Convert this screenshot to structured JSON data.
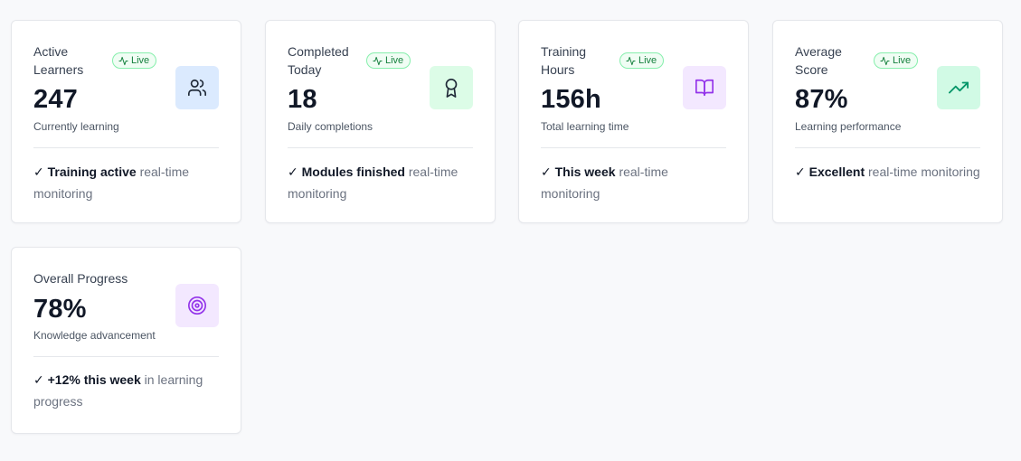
{
  "colors": {
    "live_badge_bg": "#f0fdf4",
    "live_badge_border": "#86efac",
    "live_badge_text": "#15803d",
    "blue_icon_bg": "#dbeafe",
    "green_icon_bg": "#dcfce7",
    "purple_icon_bg": "#f3e8ff",
    "purple_icon": "#9333ea",
    "green_icon": "#059669"
  },
  "cards": [
    {
      "label": "Active Learners",
      "badge": "Live",
      "icon": "users-icon",
      "value": "247",
      "subtitle": "Currently learning",
      "check": "✓",
      "footer_strong": "Training active",
      "footer_rest": "real-time monitoring"
    },
    {
      "label": "Completed Today",
      "badge": "Live",
      "icon": "award-icon",
      "value": "18",
      "subtitle": "Daily completions",
      "check": "✓",
      "footer_strong": "Modules finished",
      "footer_rest": "real-time monitoring"
    },
    {
      "label": "Training Hours",
      "badge": "Live",
      "icon": "book-open-icon",
      "value": "156h",
      "subtitle": "Total learning time",
      "check": "✓",
      "footer_strong": "This week",
      "footer_rest": "real-time monitoring"
    },
    {
      "label": "Average Score",
      "badge": "Live",
      "icon": "trending-up-icon",
      "value": "87%",
      "subtitle": "Learning performance",
      "check": "✓",
      "footer_strong": "Excellent",
      "footer_rest": "real-time monitoring"
    },
    {
      "label": "Overall Progress",
      "icon": "target-icon",
      "value": "78%",
      "subtitle": "Knowledge advancement",
      "check": "✓",
      "footer_strong": "+12% this week",
      "footer_rest": "in learning progress"
    }
  ]
}
